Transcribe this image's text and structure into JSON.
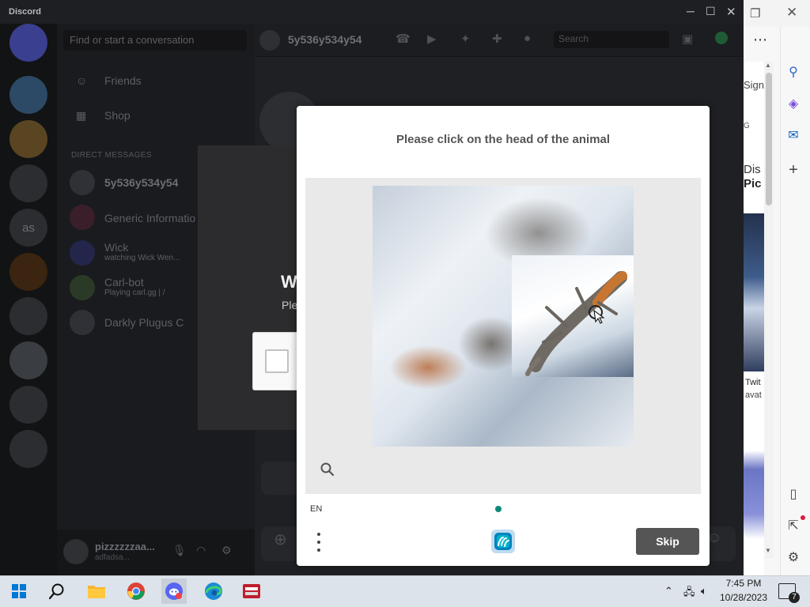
{
  "discord": {
    "app_title": "Discord",
    "search_placeholder": "Find or start a conversation",
    "nav": {
      "friends": "Friends",
      "shop": "Shop"
    },
    "direct_messages_header": "DIRECT MESSAGES",
    "dm_list": [
      {
        "name": "5y536y534y54",
        "sub": ""
      },
      {
        "name": "Generic Informatio",
        "sub": ""
      },
      {
        "name": "Wick",
        "sub": "watching Wick Wen..."
      },
      {
        "name": "Carl-bot",
        "sub": "Playing carl.gg | /"
      },
      {
        "name": "Darkly Plugus C",
        "sub": ""
      }
    ],
    "server_rail_label": "as",
    "channel_name": "5y536y534y54",
    "chat_search_placeholder": "Search",
    "modal": {
      "title": "W",
      "subtitle": "Ple"
    },
    "user": {
      "name": "pizzzzzzaa...",
      "tag": "adfadsa..."
    }
  },
  "edge": {
    "sign_in_partial": "Sign",
    "g_partial": "G",
    "dis_partial": "Dis",
    "pic_partial": "Pic",
    "twit_partial": "Twit",
    "ava_partial": "avat"
  },
  "captcha": {
    "prompt": "Please click on the head of the animal",
    "language": "EN",
    "skip_label": "Skip",
    "progress": {
      "current": 1,
      "total": 1
    }
  },
  "taskbar": {
    "time": "7:45 PM",
    "date": "10/28/2023",
    "notification_count": "7",
    "apps": [
      "start-icon",
      "search-icon",
      "file-explorer-icon",
      "chrome-icon",
      "discord-icon",
      "edge-icon",
      "filezilla-icon"
    ]
  },
  "colors": {
    "discord_bg": "#1e1f22",
    "captcha_accent": "#0c8a7b",
    "skip_button": "#555555"
  }
}
